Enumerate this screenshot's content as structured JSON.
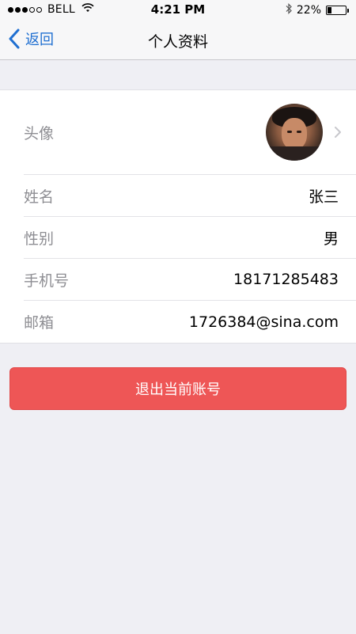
{
  "status_bar": {
    "carrier": "BELL",
    "time": "4:21 PM",
    "battery": "22%",
    "battery_level": 0.22,
    "signal_bars_filled": 3,
    "signal_bars_total": 5
  },
  "nav": {
    "back_label": "返回",
    "title": "个人资料"
  },
  "profile": {
    "avatar_label": "头像",
    "rows": [
      {
        "label": "姓名",
        "value": "张三"
      },
      {
        "label": "性别",
        "value": "男"
      },
      {
        "label": "手机号",
        "value": "18171285483"
      },
      {
        "label": "邮箱",
        "value": "1726384@sina.com"
      }
    ]
  },
  "logout_label": "退出当前账号",
  "colors": {
    "accent": "#1f6fd1",
    "danger": "#ee5656",
    "background": "#efeff4"
  }
}
